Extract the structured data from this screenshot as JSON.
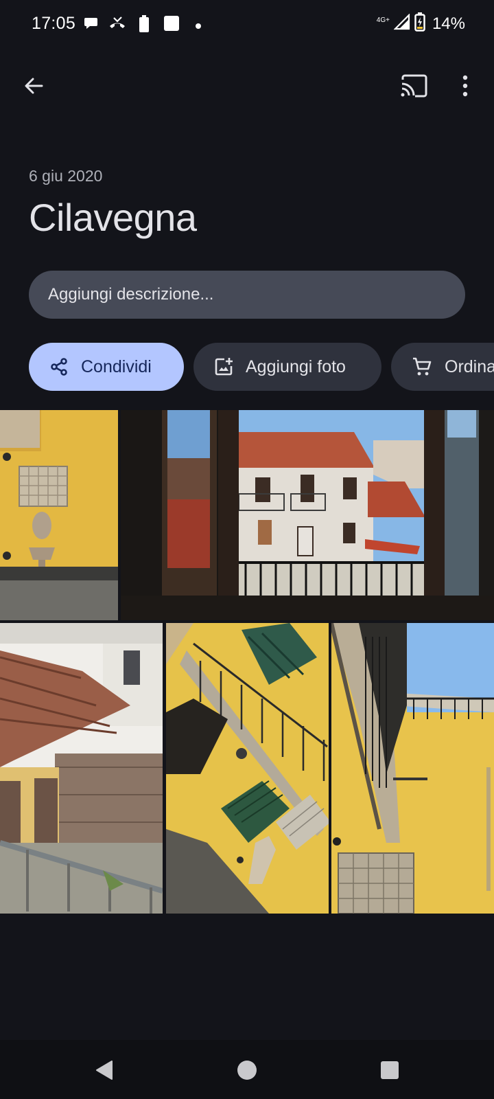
{
  "status_bar": {
    "time": "17:05",
    "network": "4G+",
    "battery": "14%"
  },
  "app_bar": {
    "back_icon": "arrow-back-icon",
    "cast_icon": "cast-icon",
    "menu_icon": "more-vert-icon"
  },
  "album": {
    "date": "6 giu 2020",
    "title": "Cilavegna",
    "description_placeholder": "Aggiungi descrizione..."
  },
  "actions": [
    {
      "label": "Condividi",
      "icon": "share-icon"
    },
    {
      "label": "Aggiungi foto",
      "icon": "add-photo-icon"
    },
    {
      "label": "Ordina",
      "icon": "shopping-cart-icon"
    }
  ],
  "photos": [
    {
      "subject": "yellow wall with fountain"
    },
    {
      "subject": "view through window of white houses"
    },
    {
      "subject": "tiled roof and gate"
    },
    {
      "subject": "yellow house with balcony"
    },
    {
      "subject": "yellow facade with balcony and sky"
    }
  ],
  "colors": {
    "background": "#13141a",
    "accent_chip": "#b3c6ff",
    "chip": "#2f323d",
    "field": "#464a57"
  },
  "nav_bar": {
    "back": "nav-back-icon",
    "home": "nav-home-icon",
    "recents": "nav-recents-icon"
  }
}
